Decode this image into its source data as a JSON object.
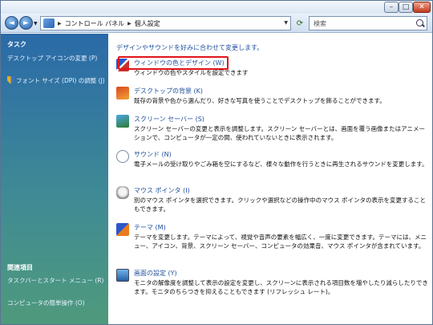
{
  "window": {
    "controls": {
      "minimize": "–",
      "maximize": "□",
      "close": "✕"
    }
  },
  "nav": {
    "back_glyph": "◄",
    "forward_glyph": "►",
    "breadcrumb": [
      "コントロール パネル",
      "個人設定"
    ],
    "search_placeholder": "検索"
  },
  "sidebar": {
    "tasks_heading": "タスク",
    "tasks": [
      {
        "label": "デスクトップ アイコンの変更 (P)",
        "icon": "none"
      },
      {
        "label": "フォント サイズ (DPI) の調整 (J)",
        "icon": "shield-icon"
      }
    ],
    "related_heading": "関連項目",
    "related": [
      {
        "label": "タスクバーとスタート メニュー (R)"
      },
      {
        "label": "コンピュータの簡単操作 (O)"
      }
    ]
  },
  "main": {
    "intro": "デザインやサウンドを好みに合わせて変更します。",
    "items": [
      {
        "title": "ウィンドウの色とデザイン (W)",
        "desc": "ウィンドウの色やスタイルを設定できます",
        "icon": "window-color-icon",
        "highlighted": true
      },
      {
        "title": "デスクトップの背景 (K)",
        "desc": "既存の背景や色から選んだり、好きな写真を使うことでデスクトップを飾ることができます。",
        "icon": "desktop-background-icon"
      },
      {
        "title": "スクリーン セーバー (S)",
        "desc": "スクリーン セーバーの変更と表示を調整します。スクリーン セーバーとは、画面を覆う画像またはアニメーションで、コンピュータが一定の間、使われていないときに表示されます。",
        "icon": "screen-saver-icon"
      },
      {
        "title": "サウンド (N)",
        "desc": "電子メールの受け取りやごみ箱を空にするなど、様々な動作を行うときに再生されるサウンドを変更します。",
        "icon": "sound-icon"
      },
      {
        "title": "マウス ポインタ (I)",
        "desc": "別のマウス ポインタを選択できます。クリックや選択などの操作中のマウス ポインタの表示を変更することもできます。",
        "icon": "mouse-pointer-icon"
      },
      {
        "title": "テーマ (M)",
        "desc": "テーマを変更します。テーマによって、視覚や音声の要素を幅広く、一度に変更できます。テーマには、メニュー、アイコン、背景、スクリーン セーバー、コンピュータの効果音、マウス ポインタが含まれています。",
        "icon": "theme-icon"
      },
      {
        "title": "画面の設定 (Y)",
        "desc": "モニタの解像度を調整して表示の設定を変更し、スクリーンに表示される項目数を増やしたり減らしたりできます。モニタのちらつきを抑えることもできます (リフレッシュ レート)。",
        "icon": "display-settings-icon"
      }
    ]
  }
}
